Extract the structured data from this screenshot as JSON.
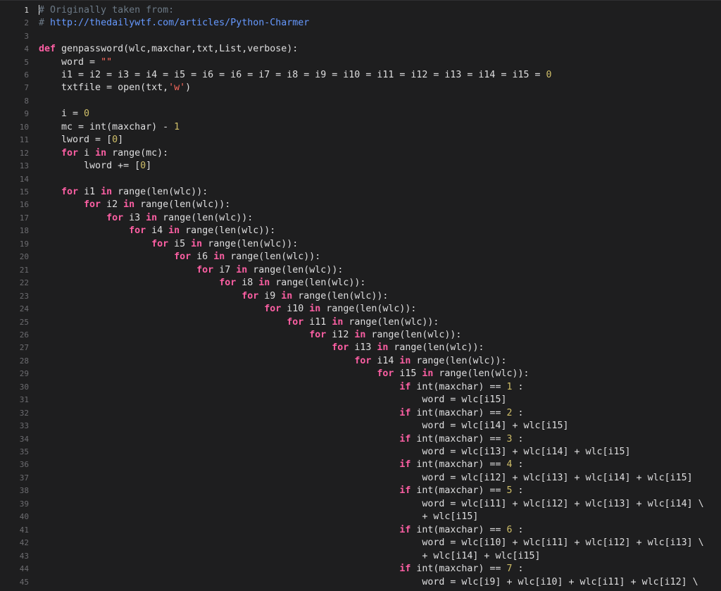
{
  "editor": {
    "language": "python",
    "current_line": 1,
    "colors": {
      "background": "#1e1e1f",
      "gutter_text": "#6c6c70",
      "keyword": "#fc5fa3",
      "comment": "#6c7986",
      "url": "#6699ff",
      "number": "#d0bf69",
      "string": "#fc6a5d",
      "plain": "#dfdfe0"
    },
    "lines": [
      {
        "number": "1",
        "tokens": [
          {
            "t": "# Originally taken from:",
            "k": "comment"
          }
        ]
      },
      {
        "number": "2",
        "tokens": [
          {
            "t": "# ",
            "k": "comment"
          },
          {
            "t": "http://thedailywtf.com/articles/Python-Charmer",
            "k": "url"
          }
        ]
      },
      {
        "number": "3",
        "tokens": []
      },
      {
        "number": "4",
        "tokens": [
          {
            "t": "def",
            "k": "keyword"
          },
          {
            "t": " genpassword(wlc,maxchar,txt,List,verbose):",
            "k": "text"
          }
        ]
      },
      {
        "number": "5",
        "tokens": [
          {
            "t": "    word = ",
            "k": "text"
          },
          {
            "t": "\"\"",
            "k": "string"
          }
        ]
      },
      {
        "number": "6",
        "tokens": [
          {
            "t": "    i1 = i2 = i3 = i4 = i5 = i6 = i6 = i7 = i8 = i9 = i10 = i11 = i12 = i13 = i14 = i15 = ",
            "k": "text"
          },
          {
            "t": "0",
            "k": "number"
          }
        ]
      },
      {
        "number": "7",
        "tokens": [
          {
            "t": "    txtfile = open(txt,",
            "k": "text"
          },
          {
            "t": "'w'",
            "k": "string"
          },
          {
            "t": ")",
            "k": "text"
          }
        ]
      },
      {
        "number": "8",
        "tokens": []
      },
      {
        "number": "9",
        "tokens": [
          {
            "t": "    i = ",
            "k": "text"
          },
          {
            "t": "0",
            "k": "number"
          }
        ]
      },
      {
        "number": "10",
        "tokens": [
          {
            "t": "    mc = int(maxchar) - ",
            "k": "text"
          },
          {
            "t": "1",
            "k": "number"
          }
        ]
      },
      {
        "number": "11",
        "tokens": [
          {
            "t": "    lword = [",
            "k": "text"
          },
          {
            "t": "0",
            "k": "number"
          },
          {
            "t": "]",
            "k": "text"
          }
        ]
      },
      {
        "number": "12",
        "tokens": [
          {
            "t": "    ",
            "k": "text"
          },
          {
            "t": "for",
            "k": "keyword"
          },
          {
            "t": " i ",
            "k": "text"
          },
          {
            "t": "in",
            "k": "keyword"
          },
          {
            "t": " range(mc):",
            "k": "text"
          }
        ]
      },
      {
        "number": "13",
        "tokens": [
          {
            "t": "        lword += [",
            "k": "text"
          },
          {
            "t": "0",
            "k": "number"
          },
          {
            "t": "]",
            "k": "text"
          }
        ]
      },
      {
        "number": "14",
        "tokens": []
      },
      {
        "number": "15",
        "tokens": [
          {
            "t": "    ",
            "k": "text"
          },
          {
            "t": "for",
            "k": "keyword"
          },
          {
            "t": " i1 ",
            "k": "text"
          },
          {
            "t": "in",
            "k": "keyword"
          },
          {
            "t": " range(len(wlc)):",
            "k": "text"
          }
        ]
      },
      {
        "number": "16",
        "tokens": [
          {
            "t": "        ",
            "k": "text"
          },
          {
            "t": "for",
            "k": "keyword"
          },
          {
            "t": " i2 ",
            "k": "text"
          },
          {
            "t": "in",
            "k": "keyword"
          },
          {
            "t": " range(len(wlc)):",
            "k": "text"
          }
        ]
      },
      {
        "number": "17",
        "tokens": [
          {
            "t": "            ",
            "k": "text"
          },
          {
            "t": "for",
            "k": "keyword"
          },
          {
            "t": " i3 ",
            "k": "text"
          },
          {
            "t": "in",
            "k": "keyword"
          },
          {
            "t": " range(len(wlc)):",
            "k": "text"
          }
        ]
      },
      {
        "number": "18",
        "tokens": [
          {
            "t": "                ",
            "k": "text"
          },
          {
            "t": "for",
            "k": "keyword"
          },
          {
            "t": " i4 ",
            "k": "text"
          },
          {
            "t": "in",
            "k": "keyword"
          },
          {
            "t": " range(len(wlc)):",
            "k": "text"
          }
        ]
      },
      {
        "number": "19",
        "tokens": [
          {
            "t": "                    ",
            "k": "text"
          },
          {
            "t": "for",
            "k": "keyword"
          },
          {
            "t": " i5 ",
            "k": "text"
          },
          {
            "t": "in",
            "k": "keyword"
          },
          {
            "t": " range(len(wlc)):",
            "k": "text"
          }
        ]
      },
      {
        "number": "20",
        "tokens": [
          {
            "t": "                        ",
            "k": "text"
          },
          {
            "t": "for",
            "k": "keyword"
          },
          {
            "t": " i6 ",
            "k": "text"
          },
          {
            "t": "in",
            "k": "keyword"
          },
          {
            "t": " range(len(wlc)):",
            "k": "text"
          }
        ]
      },
      {
        "number": "21",
        "tokens": [
          {
            "t": "                            ",
            "k": "text"
          },
          {
            "t": "for",
            "k": "keyword"
          },
          {
            "t": " i7 ",
            "k": "text"
          },
          {
            "t": "in",
            "k": "keyword"
          },
          {
            "t": " range(len(wlc)):",
            "k": "text"
          }
        ]
      },
      {
        "number": "22",
        "tokens": [
          {
            "t": "                                ",
            "k": "text"
          },
          {
            "t": "for",
            "k": "keyword"
          },
          {
            "t": " i8 ",
            "k": "text"
          },
          {
            "t": "in",
            "k": "keyword"
          },
          {
            "t": " range(len(wlc)):",
            "k": "text"
          }
        ]
      },
      {
        "number": "23",
        "tokens": [
          {
            "t": "                                    ",
            "k": "text"
          },
          {
            "t": "for",
            "k": "keyword"
          },
          {
            "t": " i9 ",
            "k": "text"
          },
          {
            "t": "in",
            "k": "keyword"
          },
          {
            "t": " range(len(wlc)):",
            "k": "text"
          }
        ]
      },
      {
        "number": "24",
        "tokens": [
          {
            "t": "                                        ",
            "k": "text"
          },
          {
            "t": "for",
            "k": "keyword"
          },
          {
            "t": " i10 ",
            "k": "text"
          },
          {
            "t": "in",
            "k": "keyword"
          },
          {
            "t": " range(len(wlc)):",
            "k": "text"
          }
        ]
      },
      {
        "number": "25",
        "tokens": [
          {
            "t": "                                            ",
            "k": "text"
          },
          {
            "t": "for",
            "k": "keyword"
          },
          {
            "t": " i11 ",
            "k": "text"
          },
          {
            "t": "in",
            "k": "keyword"
          },
          {
            "t": " range(len(wlc)):",
            "k": "text"
          }
        ]
      },
      {
        "number": "26",
        "tokens": [
          {
            "t": "                                                ",
            "k": "text"
          },
          {
            "t": "for",
            "k": "keyword"
          },
          {
            "t": " i12 ",
            "k": "text"
          },
          {
            "t": "in",
            "k": "keyword"
          },
          {
            "t": " range(len(wlc)):",
            "k": "text"
          }
        ]
      },
      {
        "number": "27",
        "tokens": [
          {
            "t": "                                                    ",
            "k": "text"
          },
          {
            "t": "for",
            "k": "keyword"
          },
          {
            "t": " i13 ",
            "k": "text"
          },
          {
            "t": "in",
            "k": "keyword"
          },
          {
            "t": " range(len(wlc)):",
            "k": "text"
          }
        ]
      },
      {
        "number": "28",
        "tokens": [
          {
            "t": "                                                        ",
            "k": "text"
          },
          {
            "t": "for",
            "k": "keyword"
          },
          {
            "t": " i14 ",
            "k": "text"
          },
          {
            "t": "in",
            "k": "keyword"
          },
          {
            "t": " range(len(wlc)):",
            "k": "text"
          }
        ]
      },
      {
        "number": "29",
        "tokens": [
          {
            "t": "                                                            ",
            "k": "text"
          },
          {
            "t": "for",
            "k": "keyword"
          },
          {
            "t": " i15 ",
            "k": "text"
          },
          {
            "t": "in",
            "k": "keyword"
          },
          {
            "t": " range(len(wlc)):",
            "k": "text"
          }
        ]
      },
      {
        "number": "30",
        "tokens": [
          {
            "t": "                                                                ",
            "k": "text"
          },
          {
            "t": "if",
            "k": "keyword"
          },
          {
            "t": " int(maxchar) == ",
            "k": "text"
          },
          {
            "t": "1",
            "k": "number"
          },
          {
            "t": " :",
            "k": "text"
          }
        ]
      },
      {
        "number": "31",
        "tokens": [
          {
            "t": "                                                                    word = wlc[i15]",
            "k": "text"
          }
        ]
      },
      {
        "number": "32",
        "tokens": [
          {
            "t": "                                                                ",
            "k": "text"
          },
          {
            "t": "if",
            "k": "keyword"
          },
          {
            "t": " int(maxchar) == ",
            "k": "text"
          },
          {
            "t": "2",
            "k": "number"
          },
          {
            "t": " :",
            "k": "text"
          }
        ]
      },
      {
        "number": "33",
        "tokens": [
          {
            "t": "                                                                    word = wlc[i14] + wlc[i15]",
            "k": "text"
          }
        ]
      },
      {
        "number": "34",
        "tokens": [
          {
            "t": "                                                                ",
            "k": "text"
          },
          {
            "t": "if",
            "k": "keyword"
          },
          {
            "t": " int(maxchar) == ",
            "k": "text"
          },
          {
            "t": "3",
            "k": "number"
          },
          {
            "t": " :",
            "k": "text"
          }
        ]
      },
      {
        "number": "35",
        "tokens": [
          {
            "t": "                                                                    word = wlc[i13] + wlc[i14] + wlc[i15]",
            "k": "text"
          }
        ]
      },
      {
        "number": "36",
        "tokens": [
          {
            "t": "                                                                ",
            "k": "text"
          },
          {
            "t": "if",
            "k": "keyword"
          },
          {
            "t": " int(maxchar) == ",
            "k": "text"
          },
          {
            "t": "4",
            "k": "number"
          },
          {
            "t": " :",
            "k": "text"
          }
        ]
      },
      {
        "number": "37",
        "tokens": [
          {
            "t": "                                                                    word = wlc[i12] + wlc[i13] + wlc[i14] + wlc[i15]",
            "k": "text"
          }
        ]
      },
      {
        "number": "38",
        "tokens": [
          {
            "t": "                                                                ",
            "k": "text"
          },
          {
            "t": "if",
            "k": "keyword"
          },
          {
            "t": " int(maxchar) == ",
            "k": "text"
          },
          {
            "t": "5",
            "k": "number"
          },
          {
            "t": " :",
            "k": "text"
          }
        ]
      },
      {
        "number": "39",
        "tokens": [
          {
            "t": "                                                                    word = wlc[i11] + wlc[i12] + wlc[i13] + wlc[i14] \\",
            "k": "text"
          }
        ]
      },
      {
        "number": "40",
        "tokens": [
          {
            "t": "                                                                    + wlc[i15]",
            "k": "text"
          }
        ]
      },
      {
        "number": "41",
        "tokens": [
          {
            "t": "                                                                ",
            "k": "text"
          },
          {
            "t": "if",
            "k": "keyword"
          },
          {
            "t": " int(maxchar) == ",
            "k": "text"
          },
          {
            "t": "6",
            "k": "number"
          },
          {
            "t": " :",
            "k": "text"
          }
        ]
      },
      {
        "number": "42",
        "tokens": [
          {
            "t": "                                                                    word = wlc[i10] + wlc[i11] + wlc[i12] + wlc[i13] \\",
            "k": "text"
          }
        ]
      },
      {
        "number": "43",
        "tokens": [
          {
            "t": "                                                                    + wlc[i14] + wlc[i15]",
            "k": "text"
          }
        ]
      },
      {
        "number": "44",
        "tokens": [
          {
            "t": "                                                                ",
            "k": "text"
          },
          {
            "t": "if",
            "k": "keyword"
          },
          {
            "t": " int(maxchar) == ",
            "k": "text"
          },
          {
            "t": "7",
            "k": "number"
          },
          {
            "t": " :",
            "k": "text"
          }
        ]
      },
      {
        "number": "45",
        "tokens": [
          {
            "t": "                                                                    word = wlc[i9] + wlc[i10] + wlc[i11] + wlc[i12] \\",
            "k": "text"
          }
        ]
      }
    ]
  }
}
